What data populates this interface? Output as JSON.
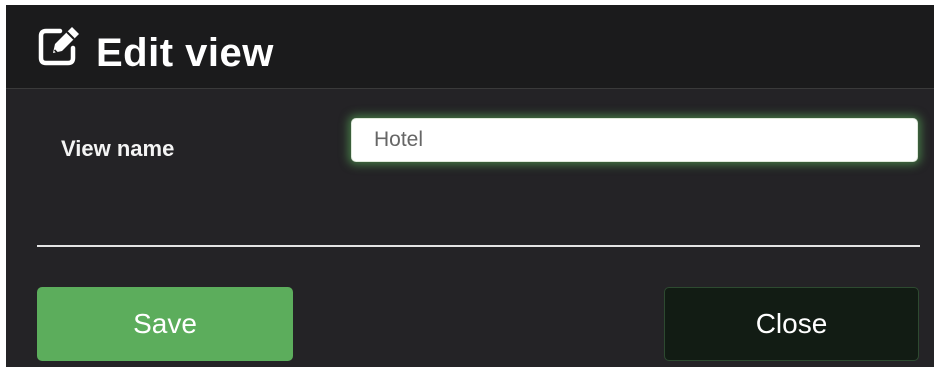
{
  "dialog": {
    "title": "Edit view",
    "title_icon": "edit-icon"
  },
  "form": {
    "view_name_label": "View name",
    "view_name_value": "Hotel"
  },
  "footer": {
    "save_label": "Save",
    "close_label": "Close"
  },
  "colors": {
    "save_button": "#5cad5c",
    "close_button": "#121c14",
    "dialog_background": "#242326",
    "focus_glow": "#5cb85c"
  }
}
